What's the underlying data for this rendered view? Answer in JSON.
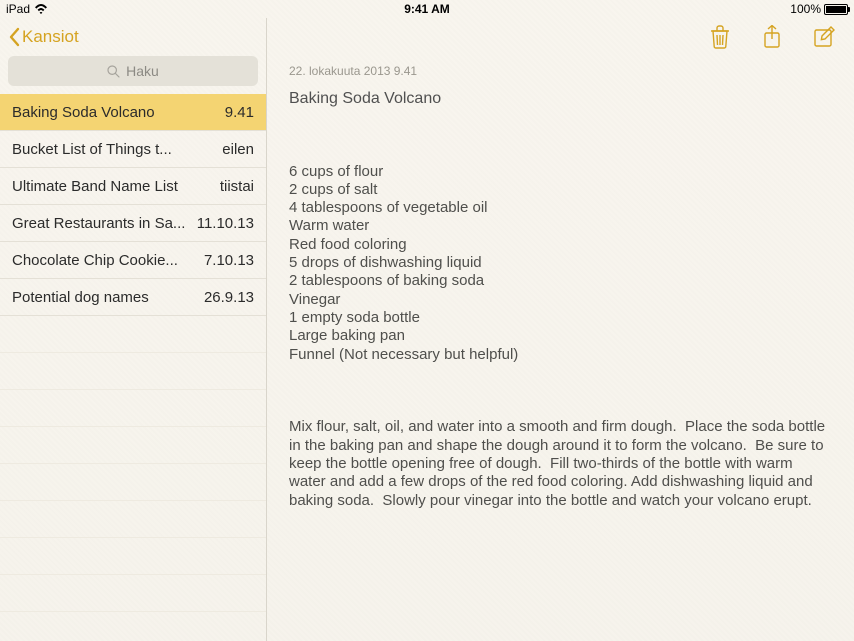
{
  "status": {
    "device": "iPad",
    "time": "9:41 AM",
    "battery_pct": "100%"
  },
  "accent": "#d5a321",
  "sidebar": {
    "back_label": "Kansiot",
    "search_placeholder": "Haku",
    "items": [
      {
        "title": "Baking Soda Volcano",
        "date": "9.41",
        "selected": true
      },
      {
        "title": "Bucket List of Things t...",
        "date": "eilen",
        "selected": false
      },
      {
        "title": "Ultimate Band Name List",
        "date": "tiistai",
        "selected": false
      },
      {
        "title": "Great Restaurants in Sa...",
        "date": "11.10.13",
        "selected": false
      },
      {
        "title": "Chocolate Chip Cookie...",
        "date": "7.10.13",
        "selected": false
      },
      {
        "title": "Potential dog names",
        "date": "26.9.13",
        "selected": false
      }
    ]
  },
  "note": {
    "timestamp": "22. lokakuuta 2013 9.41",
    "title": "Baking Soda Volcano",
    "body_lines": [
      "6 cups of flour",
      "2 cups of salt",
      "4 tablespoons of vegetable oil",
      "Warm water",
      "Red food coloring",
      "5 drops of dishwashing liquid",
      "2 tablespoons of baking soda",
      "Vinegar",
      "1 empty soda bottle",
      "Large baking pan",
      "Funnel (Not necessary but helpful)"
    ],
    "body_paragraph": "Mix flour, salt, oil, and water into a smooth and firm dough.  Place the soda bottle in the baking pan and shape the dough around it to form the volcano.  Be sure to keep the bottle opening free of dough.  Fill two-thirds of the bottle with warm water and add a few drops of the red food coloring. Add dishwashing liquid and baking soda.  Slowly pour vinegar into the bottle and watch your volcano erupt."
  }
}
